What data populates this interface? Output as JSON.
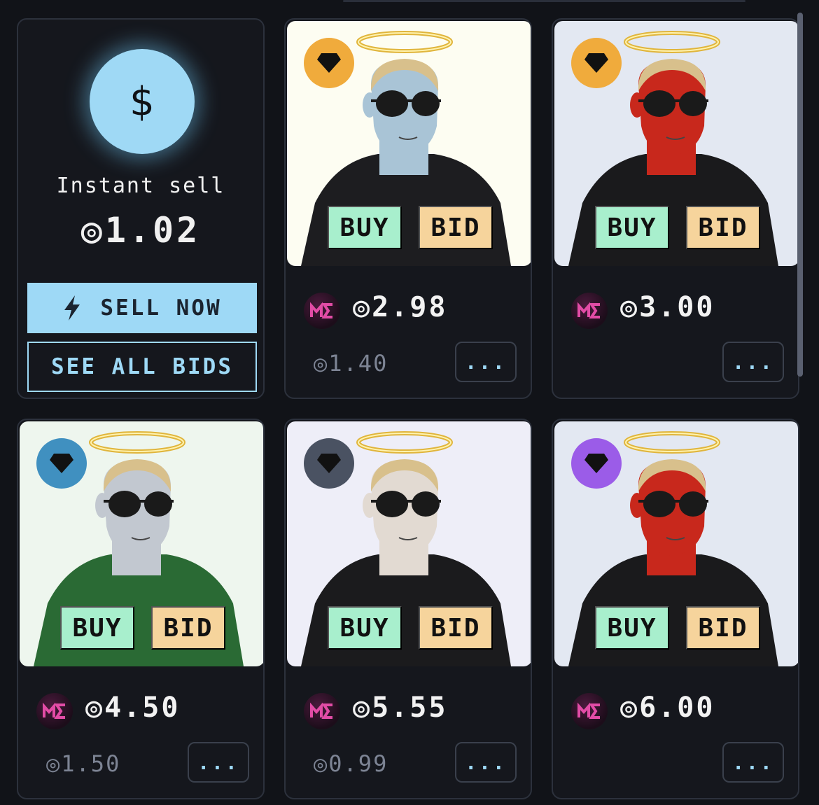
{
  "instant_sell": {
    "label": "Instant sell",
    "price": "◎1.02",
    "sell_now_label": "SELL NOW",
    "see_all_bids_label": "SEE ALL BIDS",
    "coin_symbol": "$"
  },
  "listings": [
    {
      "tier_color": "#f0ab3c",
      "bg": "#fdfdf2",
      "skin": "#a9c4d6",
      "top": "#1d1d20",
      "price": "◎2.98",
      "last_bid": "◎1.40",
      "buy_label": "BUY",
      "bid_label": "BID",
      "more_label": "..."
    },
    {
      "tier_color": "#f0ab3c",
      "bg": "#e3e8f2",
      "skin": "#c8281c",
      "top": "#1a1a1c",
      "price": "◎3.00",
      "last_bid": "",
      "buy_label": "BUY",
      "bid_label": "BID",
      "more_label": "..."
    },
    {
      "tier_color": "#4090c0",
      "bg": "#eef6ee",
      "skin": "#c2c8d0",
      "top": "#2a6a34",
      "price": "◎4.50",
      "last_bid": "◎1.50",
      "buy_label": "BUY",
      "bid_label": "BID",
      "more_label": "..."
    },
    {
      "tier_color": "#4a5262",
      "bg": "#eeeef8",
      "skin": "#e2dad2",
      "top": "#1b1b1d",
      "price": "◎5.55",
      "last_bid": "◎0.99",
      "buy_label": "BUY",
      "bid_label": "BID",
      "more_label": "..."
    },
    {
      "tier_color": "#9b5ce8",
      "bg": "#e3e8f2",
      "skin": "#c8281c",
      "top": "#1a1a1c",
      "price": "◎6.00",
      "last_bid": "",
      "buy_label": "BUY",
      "bid_label": "BID",
      "more_label": "..."
    }
  ],
  "icons": {
    "tier": "diamond-icon",
    "marketplace": "magic-eden-logo-icon",
    "sell": "lightning-icon"
  }
}
